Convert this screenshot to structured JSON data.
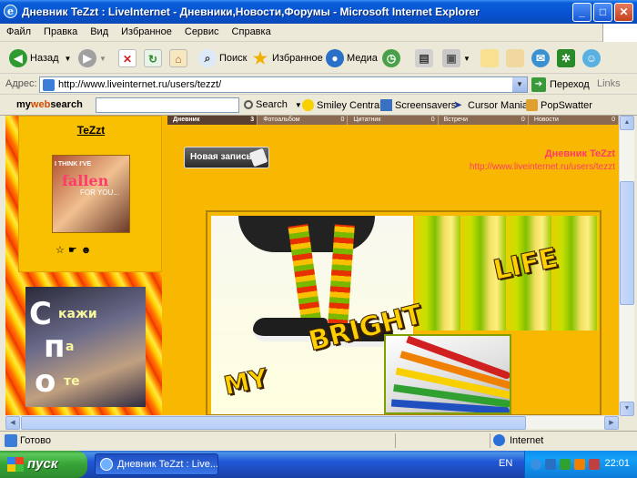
{
  "window": {
    "title": "Дневник TeZzt : LiveInternet - Дневники,Новости,Форумы - Microsoft Internet Explorer",
    "min_glyph": "_",
    "max_glyph": "□",
    "close_glyph": "✕"
  },
  "menu": [
    "Файл",
    "Правка",
    "Вид",
    "Избранное",
    "Сервис",
    "Справка"
  ],
  "toolbar": {
    "back_label": "Назад",
    "search_label": "Поиск",
    "favorites_label": "Избранное",
    "media_label": "Медиа"
  },
  "address": {
    "label": "Адрес:",
    "url": "http://www.liveinternet.ru/users/tezzt/",
    "go_label": "Переход",
    "links_label": "Links"
  },
  "mws": {
    "logo_my": "my",
    "logo_web": "web",
    "logo_search": "search",
    "search_value": "",
    "search_label": "Search",
    "smiley_label": "Smiley Central",
    "screensavers_label": "Screensavers",
    "cursor_label": "Cursor Mania",
    "popswatter_label": "PopSwatter"
  },
  "page": {
    "username": "TeZzt",
    "avatar_line1": "I THINK I'VE",
    "avatar_line2": "fallen",
    "avatar_line3": "FOR YOU...",
    "tabs": [
      {
        "label": "Дневник",
        "count": "3"
      },
      {
        "label": "Фотоальбом",
        "count": "0"
      },
      {
        "label": "Цитатник",
        "count": "0"
      },
      {
        "label": "Встречи",
        "count": "0"
      },
      {
        "label": "Новости",
        "count": "0"
      }
    ],
    "new_post_label": "Новая запись",
    "blog_title": "Дневник TeZzt",
    "blog_url": "http://www.liveinternet.ru/users/tezzt",
    "banner_letters": [
      "С",
      "п",
      "о"
    ],
    "banner_words": [
      "кажи",
      "а",
      "те"
    ],
    "art_words": [
      "MY",
      "BRIGHT",
      "LIFE"
    ]
  },
  "status": {
    "text": "Готово",
    "zone": "Internet"
  },
  "taskbar": {
    "start_label": "пуск",
    "task_label": "Дневник TeZzt : Live...",
    "lang": "EN",
    "clock": "22:01"
  },
  "colors": {
    "accent_pink": "#ff3b6b",
    "zebra_orange": "#ff7a00",
    "xp_blue": "#0752d1"
  }
}
